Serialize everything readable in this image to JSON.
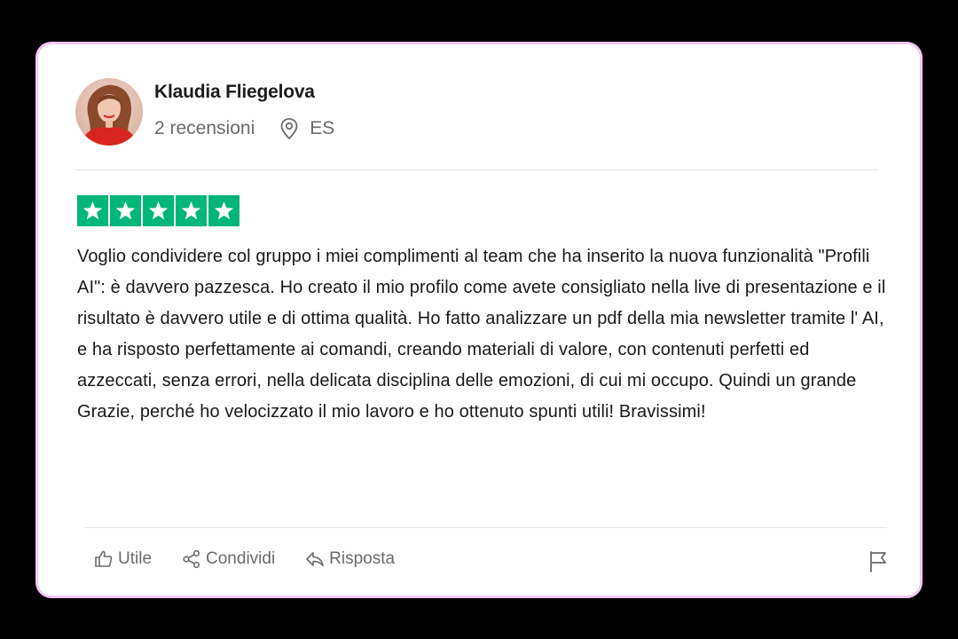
{
  "reviewer": {
    "name": "Klaudia Fliegelova",
    "review_count": "2 recensioni",
    "country": "ES"
  },
  "rating": {
    "stars": 5,
    "max": 5,
    "star_color": "#00b67a"
  },
  "review": {
    "text": "Voglio condividere col gruppo i miei complimenti al team che ha inserito la nuova funzionalità \"Profili AI\": è davvero pazzesca. Ho creato il mio profilo come avete consigliato nella live di presentazione e il risultato è davvero utile e di ottima qualità. Ho fatto analizzare un pdf della mia newsletter tramite l' AI, e ha risposto perfettamente ai comandi, creando materiali di valore, con contenuti perfetti ed azzeccati, senza errori, nella delicata disciplina delle emozioni, di cui mi occupo. Quindi un grande Grazie, perché ho velocizzato il mio lavoro e ho ottenuto spunti utili! Bravissimi!"
  },
  "actions": {
    "useful_label": "Utile",
    "share_label": "Condividi",
    "reply_label": "Risposta"
  },
  "icons": {
    "location": "map-pin-icon",
    "useful": "thumbs-up-icon",
    "share": "share-icon",
    "reply": "reply-icon",
    "report": "flag-icon"
  },
  "colors": {
    "card_border": "#f5c6f5",
    "background": "#000000",
    "muted_text": "#6b6b6b"
  }
}
